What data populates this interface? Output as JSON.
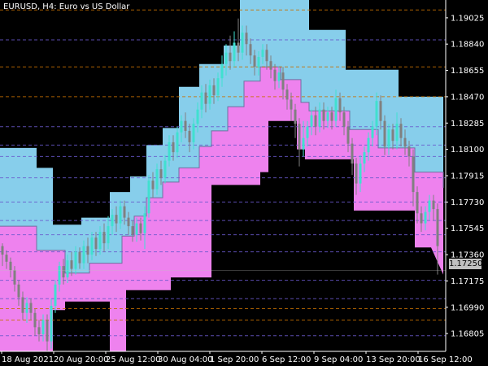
{
  "window": {
    "symbol": "EURUSD",
    "timeframe": "H4",
    "description": "Euro vs US Dollar"
  },
  "chart_data": {
    "type": "candlestick",
    "symbol": "EURUSD",
    "timeframe": "H4",
    "title": "EURUSD, H4:  Euro vs US Dollar",
    "current_price_label": "1.17250",
    "current_price": 1.1725,
    "y_ticks": [
      "1.19025",
      "1.18840",
      "1.18655",
      "1.18470",
      "1.18285",
      "1.18100",
      "1.17915",
      "1.17730",
      "1.17545",
      "1.17360",
      "1.17175",
      "1.16990",
      "1.16805"
    ],
    "x_ticks": [
      "18 Aug 2021",
      "20 Aug 20:00",
      "25 Aug 12:00",
      "30 Aug 04:00",
      "1 Sep 20:00",
      "6 Sep 12:00",
      "9 Sep 04:00",
      "13 Sep 20:00",
      "16 Sep 12:00"
    ],
    "ylim": [
      1.1668,
      1.1915
    ],
    "grid": true,
    "colors": {
      "background": "#000000",
      "upper_band": "#87ceeb",
      "lower_band": "#ee82ee",
      "bull_candle": "#40e0d0",
      "bear_candle": "#808080",
      "dashed_orange": "#c87000",
      "dashed_violet": "#6a5acd",
      "grid": "#5a5a7a",
      "badge": "#c0c0c0"
    },
    "upper_band_top": [
      [
        0,
        1.1811
      ],
      [
        45,
        1.1811
      ],
      [
        45,
        1.1797
      ],
      [
        65,
        1.1797
      ],
      [
        65,
        1.1757
      ],
      [
        100,
        1.1757
      ],
      [
        100,
        1.1762
      ],
      [
        135,
        1.1762
      ],
      [
        135,
        1.178
      ],
      [
        160,
        1.178
      ],
      [
        160,
        1.1791
      ],
      [
        180,
        1.1791
      ],
      [
        180,
        1.1813
      ],
      [
        200,
        1.1813
      ],
      [
        200,
        1.1825
      ],
      [
        220,
        1.1825
      ],
      [
        220,
        1.1854
      ],
      [
        245,
        1.1854
      ],
      [
        245,
        1.187
      ],
      [
        275,
        1.187
      ],
      [
        275,
        1.1883
      ],
      [
        295,
        1.1883
      ],
      [
        295,
        1.1915
      ],
      [
        380,
        1.1915
      ],
      [
        380,
        1.1894
      ],
      [
        425,
        1.1894
      ],
      [
        425,
        1.1866
      ],
      [
        490,
        1.1866
      ],
      [
        490,
        1.1847
      ],
      [
        545,
        1.1847
      ],
      [
        545,
        1.1783
      ]
    ],
    "band_mid_line": [
      [
        0,
        1.1756
      ],
      [
        45,
        1.1756
      ],
      [
        45,
        1.1739
      ],
      [
        80,
        1.1739
      ],
      [
        80,
        1.1723
      ],
      [
        110,
        1.1723
      ],
      [
        110,
        1.173
      ],
      [
        150,
        1.173
      ],
      [
        150,
        1.1749
      ],
      [
        165,
        1.1749
      ],
      [
        165,
        1.1763
      ],
      [
        180,
        1.1763
      ],
      [
        180,
        1.1776
      ],
      [
        200,
        1.1776
      ],
      [
        200,
        1.1787
      ],
      [
        220,
        1.1787
      ],
      [
        220,
        1.1797
      ],
      [
        245,
        1.1797
      ],
      [
        245,
        1.1812
      ],
      [
        260,
        1.1812
      ],
      [
        260,
        1.1823
      ],
      [
        280,
        1.1823
      ],
      [
        280,
        1.184
      ],
      [
        300,
        1.184
      ],
      [
        300,
        1.1858
      ],
      [
        320,
        1.1858
      ],
      [
        320,
        1.1868
      ],
      [
        345,
        1.1868
      ],
      [
        345,
        1.1859
      ],
      [
        370,
        1.1859
      ],
      [
        370,
        1.1843
      ],
      [
        380,
        1.1843
      ],
      [
        380,
        1.1837
      ],
      [
        415,
        1.1837
      ],
      [
        415,
        1.1837
      ],
      [
        430,
        1.1837
      ],
      [
        430,
        1.1824
      ],
      [
        465,
        1.1824
      ],
      [
        465,
        1.1811
      ],
      [
        510,
        1.1811
      ],
      [
        510,
        1.1794
      ],
      [
        545,
        1.1794
      ],
      [
        545,
        1.1783
      ]
    ],
    "lower_band_bottom": [
      [
        0,
        1.1668
      ],
      [
        20,
        1.1668
      ],
      [
        20,
        1.1668
      ],
      [
        65,
        1.1668
      ],
      [
        65,
        1.1697
      ],
      [
        80,
        1.1697
      ],
      [
        80,
        1.1703
      ],
      [
        135,
        1.1703
      ],
      [
        135,
        1.1668
      ],
      [
        155,
        1.1668
      ],
      [
        155,
        1.1711
      ],
      [
        210,
        1.1711
      ],
      [
        210,
        1.172
      ],
      [
        260,
        1.172
      ],
      [
        260,
        1.1785
      ],
      [
        320,
        1.1785
      ],
      [
        320,
        1.1794
      ],
      [
        330,
        1.1794
      ],
      [
        330,
        1.183
      ],
      [
        365,
        1.183
      ],
      [
        365,
        1.181
      ],
      [
        375,
        1.181
      ],
      [
        375,
        1.1803
      ],
      [
        435,
        1.1803
      ],
      [
        435,
        1.1767
      ],
      [
        510,
        1.1767
      ],
      [
        510,
        1.1741
      ],
      [
        530,
        1.1741
      ],
      [
        530,
        1.1741
      ],
      [
        545,
        1.1722
      ]
    ],
    "candles": [
      [
        3,
        1.1742,
        1.1736,
        1.1744,
        1.1728
      ],
      [
        8,
        1.1736,
        1.1731,
        1.1739,
        1.1726
      ],
      [
        13,
        1.1731,
        1.1725,
        1.1734,
        1.172
      ],
      [
        18,
        1.1725,
        1.1715,
        1.1728,
        1.171
      ],
      [
        23,
        1.1715,
        1.1706,
        1.1718,
        1.17
      ],
      [
        28,
        1.1706,
        1.1695,
        1.171,
        1.169
      ],
      [
        33,
        1.1695,
        1.1702,
        1.1706,
        1.1688
      ],
      [
        38,
        1.1702,
        1.1695,
        1.1705,
        1.169
      ],
      [
        43,
        1.1695,
        1.1685,
        1.1698,
        1.1679
      ],
      [
        48,
        1.1685,
        1.168,
        1.169,
        1.1675
      ],
      [
        53,
        1.168,
        1.169,
        1.1694,
        1.1675
      ],
      [
        58,
        1.169,
        1.1675,
        1.1694,
        1.1668
      ],
      [
        63,
        1.1675,
        1.17,
        1.1705,
        1.167
      ],
      [
        68,
        1.17,
        1.1715,
        1.1718,
        1.1695
      ],
      [
        73,
        1.1715,
        1.1728,
        1.1731,
        1.171
      ],
      [
        78,
        1.1728,
        1.172,
        1.1733,
        1.1715
      ],
      [
        83,
        1.172,
        1.1732,
        1.1736,
        1.1716
      ],
      [
        88,
        1.1732,
        1.1726,
        1.1738,
        1.1721
      ],
      [
        93,
        1.1726,
        1.1738,
        1.1742,
        1.1722
      ],
      [
        98,
        1.1738,
        1.173,
        1.1741,
        1.1726
      ],
      [
        103,
        1.173,
        1.1742,
        1.1746,
        1.1726
      ],
      [
        108,
        1.1742,
        1.1736,
        1.1748,
        1.173
      ],
      [
        113,
        1.1736,
        1.1748,
        1.1752,
        1.1732
      ],
      [
        118,
        1.1748,
        1.174,
        1.1752,
        1.1735
      ],
      [
        123,
        1.174,
        1.1752,
        1.1756,
        1.1736
      ],
      [
        128,
        1.1752,
        1.1744,
        1.1758,
        1.1738
      ],
      [
        133,
        1.1744,
        1.1756,
        1.1763,
        1.174
      ],
      [
        138,
        1.1756,
        1.1764,
        1.1768,
        1.175
      ],
      [
        143,
        1.1764,
        1.1758,
        1.177,
        1.1752
      ],
      [
        148,
        1.1758,
        1.177,
        1.1774,
        1.1754
      ],
      [
        153,
        1.177,
        1.1762,
        1.1774,
        1.1757
      ],
      [
        158,
        1.1762,
        1.1756,
        1.1766,
        1.175
      ],
      [
        163,
        1.1756,
        1.175,
        1.176,
        1.1745
      ],
      [
        168,
        1.175,
        1.1758,
        1.1762,
        1.1745
      ],
      [
        173,
        1.1758,
        1.1751,
        1.1762,
        1.1746
      ],
      [
        178,
        1.1751,
        1.1765,
        1.177,
        1.174
      ],
      [
        183,
        1.1765,
        1.1788,
        1.1792,
        1.1762
      ],
      [
        188,
        1.1788,
        1.1782,
        1.1794,
        1.1776
      ],
      [
        193,
        1.1782,
        1.1796,
        1.18,
        1.1778
      ],
      [
        198,
        1.1796,
        1.179,
        1.1802,
        1.1785
      ],
      [
        203,
        1.179,
        1.1802,
        1.1806,
        1.1786
      ],
      [
        208,
        1.1802,
        1.1815,
        1.182,
        1.1798
      ],
      [
        213,
        1.1815,
        1.1808,
        1.182,
        1.1802
      ],
      [
        218,
        1.1808,
        1.1822,
        1.1826,
        1.1804
      ],
      [
        223,
        1.1822,
        1.183,
        1.1834,
        1.1815
      ],
      [
        228,
        1.183,
        1.1823,
        1.1836,
        1.1818
      ],
      [
        233,
        1.1823,
        1.1815,
        1.1828,
        1.1808
      ],
      [
        238,
        1.1815,
        1.1828,
        1.1832,
        1.181
      ],
      [
        243,
        1.1828,
        1.1838,
        1.1843,
        1.1822
      ],
      [
        248,
        1.1838,
        1.185,
        1.1855,
        1.1832
      ],
      [
        253,
        1.185,
        1.1842,
        1.1856,
        1.1836
      ],
      [
        258,
        1.1842,
        1.1855,
        1.1859,
        1.1838
      ],
      [
        263,
        1.1855,
        1.1848,
        1.186,
        1.1842
      ],
      [
        268,
        1.1848,
        1.186,
        1.1864,
        1.1844
      ],
      [
        273,
        1.186,
        1.187,
        1.1876,
        1.1854
      ],
      [
        278,
        1.187,
        1.1878,
        1.1884,
        1.1862
      ],
      [
        283,
        1.1878,
        1.1872,
        1.189,
        1.1866
      ],
      [
        288,
        1.1872,
        1.1885,
        1.1893,
        1.1868
      ],
      [
        293,
        1.1885,
        1.1878,
        1.1902,
        1.1872
      ],
      [
        298,
        1.1878,
        1.1892,
        1.1897,
        1.1873
      ],
      [
        303,
        1.1892,
        1.1884,
        1.1897,
        1.1876
      ],
      [
        308,
        1.1884,
        1.1876,
        1.1888,
        1.187
      ],
      [
        313,
        1.1876,
        1.1868,
        1.188,
        1.1862
      ],
      [
        318,
        1.1868,
        1.1875,
        1.1879,
        1.1862
      ],
      [
        323,
        1.1875,
        1.188,
        1.1884,
        1.187
      ],
      [
        328,
        1.188,
        1.1872,
        1.1884,
        1.1866
      ],
      [
        333,
        1.1872,
        1.1866,
        1.1876,
        1.186
      ],
      [
        338,
        1.1866,
        1.1858,
        1.187,
        1.1852
      ],
      [
        343,
        1.1858,
        1.1864,
        1.1868,
        1.1853
      ],
      [
        348,
        1.1864,
        1.1852,
        1.1868,
        1.1845
      ],
      [
        353,
        1.1852,
        1.1845,
        1.1856,
        1.1838
      ],
      [
        358,
        1.1845,
        1.1838,
        1.185,
        1.183
      ],
      [
        363,
        1.1838,
        1.1828,
        1.1842,
        1.1818
      ],
      [
        368,
        1.1828,
        1.181,
        1.1832,
        1.1798
      ],
      [
        373,
        1.181,
        1.1818,
        1.183,
        1.1805
      ],
      [
        378,
        1.1818,
        1.1826,
        1.183,
        1.1812
      ],
      [
        383,
        1.1826,
        1.1834,
        1.1838,
        1.182
      ],
      [
        388,
        1.1834,
        1.1826,
        1.184,
        1.182
      ],
      [
        393,
        1.1826,
        1.1838,
        1.1843,
        1.1822
      ],
      [
        398,
        1.1838,
        1.183,
        1.1843,
        1.1824
      ],
      [
        403,
        1.183,
        1.1836,
        1.184,
        1.1825
      ],
      [
        408,
        1.1836,
        1.183,
        1.184,
        1.1824
      ],
      [
        413,
        1.183,
        1.1846,
        1.1852,
        1.1826
      ],
      [
        418,
        1.1846,
        1.1836,
        1.185,
        1.183
      ],
      [
        423,
        1.1836,
        1.1826,
        1.184,
        1.182
      ],
      [
        428,
        1.1826,
        1.1814,
        1.183,
        1.1808
      ],
      [
        433,
        1.1814,
        1.18,
        1.1818,
        1.1792
      ],
      [
        438,
        1.18,
        1.1786,
        1.1804,
        1.1778
      ],
      [
        443,
        1.1786,
        1.18,
        1.1806,
        1.178
      ],
      [
        448,
        1.18,
        1.1808,
        1.1812,
        1.1794
      ],
      [
        453,
        1.1808,
        1.1818,
        1.1822,
        1.1802
      ],
      [
        458,
        1.1818,
        1.1826,
        1.183,
        1.1812
      ],
      [
        463,
        1.1826,
        1.1844,
        1.185,
        1.182
      ],
      [
        468,
        1.1844,
        1.183,
        1.1848,
        1.1824
      ],
      [
        473,
        1.183,
        1.1812,
        1.1834,
        1.1806
      ],
      [
        478,
        1.1812,
        1.1824,
        1.1828,
        1.1806
      ],
      [
        483,
        1.1824,
        1.1816,
        1.1828,
        1.181
      ],
      [
        488,
        1.1816,
        1.1828,
        1.1836,
        1.181
      ],
      [
        493,
        1.1828,
        1.1818,
        1.1832,
        1.1812
      ],
      [
        498,
        1.1818,
        1.1812,
        1.1824,
        1.1806
      ],
      [
        503,
        1.1812,
        1.1805,
        1.1816,
        1.1798
      ],
      [
        508,
        1.1805,
        1.178,
        1.181,
        1.177
      ],
      [
        513,
        1.178,
        1.1765,
        1.1784,
        1.1758
      ],
      [
        518,
        1.1765,
        1.1758,
        1.177,
        1.1752
      ],
      [
        523,
        1.1758,
        1.1766,
        1.177,
        1.1753
      ],
      [
        528,
        1.1766,
        1.1774,
        1.1778,
        1.176
      ],
      [
        533,
        1.1774,
        1.1768,
        1.1778,
        1.176
      ],
      [
        538,
        1.1768,
        1.1742,
        1.1772,
        1.1722
      ]
    ],
    "dashed_levels": [
      {
        "price": 1.1908,
        "color": "dashed_orange"
      },
      {
        "price": 1.1887,
        "color": "dashed_violet"
      },
      {
        "price": 1.1868,
        "color": "dashed_orange"
      },
      {
        "price": 1.1847,
        "color": "dashed_orange"
      },
      {
        "price": 1.1826,
        "color": "dashed_violet"
      },
      {
        "price": 1.1813,
        "color": "dashed_violet"
      },
      {
        "price": 1.1805,
        "color": "dashed_violet"
      },
      {
        "price": 1.179,
        "color": "dashed_violet"
      },
      {
        "price": 1.1773,
        "color": "dashed_violet"
      },
      {
        "price": 1.176,
        "color": "dashed_violet"
      },
      {
        "price": 1.175,
        "color": "dashed_violet"
      },
      {
        "price": 1.1738,
        "color": "dashed_violet"
      },
      {
        "price": 1.1718,
        "color": "dashed_violet"
      },
      {
        "price": 1.1705,
        "color": "dashed_violet"
      },
      {
        "price": 1.1698,
        "color": "dashed_orange"
      },
      {
        "price": 1.169,
        "color": "dashed_orange"
      },
      {
        "price": 1.1679,
        "color": "dashed_violet"
      }
    ]
  }
}
